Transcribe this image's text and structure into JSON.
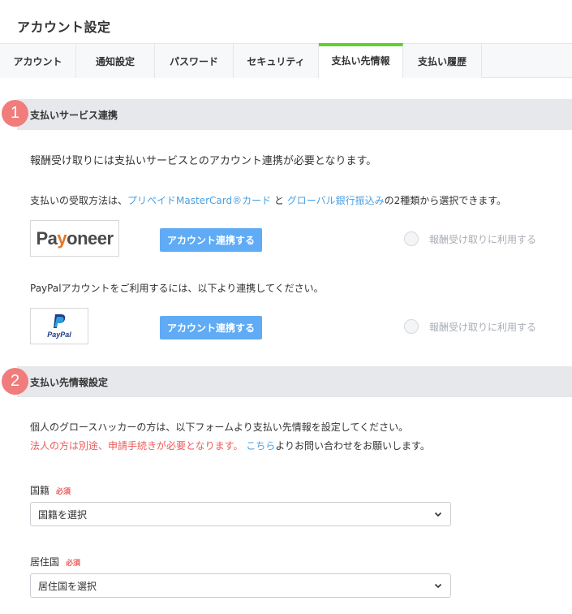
{
  "page": {
    "title": "アカウント設定"
  },
  "tabs": [
    {
      "label": "アカウント"
    },
    {
      "label": "通知設定"
    },
    {
      "label": "パスワード"
    },
    {
      "label": "セキュリティ"
    },
    {
      "label": "支払い先情報",
      "active": true
    },
    {
      "label": "支払い履歴"
    }
  ],
  "accent_colors": {
    "tab_active": "#5fd12b",
    "badge": "#f07c7c",
    "button": "#5fabf5",
    "link": "#4a9fe0",
    "warning": "#ee5a5a"
  },
  "section1": {
    "number": "1",
    "title": "支払いサービス連携",
    "intro": "報酬受け取りには支払いサービスとのアカウント連携が必要となります。",
    "methods_prefix": "支払いの受取方法は、",
    "method_a": "プリペイドMasterCard®カード",
    "methods_and": " と ",
    "method_b": "グローバル銀行振込み",
    "methods_suffix": "の2種類から選択できます。",
    "payoneer": {
      "logo_text_a": "Pa",
      "logo_text_y": "y",
      "logo_text_b": "oneer",
      "button": "アカウント連携する",
      "radio_label": "報酬受け取りに利用する"
    },
    "paypal_note": "PayPalアカウントをご利用するには、以下より連携してください。",
    "paypal": {
      "logo_text": "PayPal",
      "button": "アカウント連携する",
      "radio_label": "報酬受け取りに利用する"
    }
  },
  "section2": {
    "number": "2",
    "title": "支払い先情報設定",
    "line1": "個人のグロースハッカーの方は、以下フォームより支払い先情報を設定してください。",
    "line2_red": "法人の方は別途、申請手続きが必要となります。",
    "line2_link": "こちら",
    "line2_suffix": "よりお問い合わせをお願いします。",
    "fields": [
      {
        "label": "国籍",
        "required": "必須",
        "value": "国籍を選択"
      },
      {
        "label": "居住国",
        "required": "必須",
        "value": "居住国を選択"
      }
    ]
  }
}
